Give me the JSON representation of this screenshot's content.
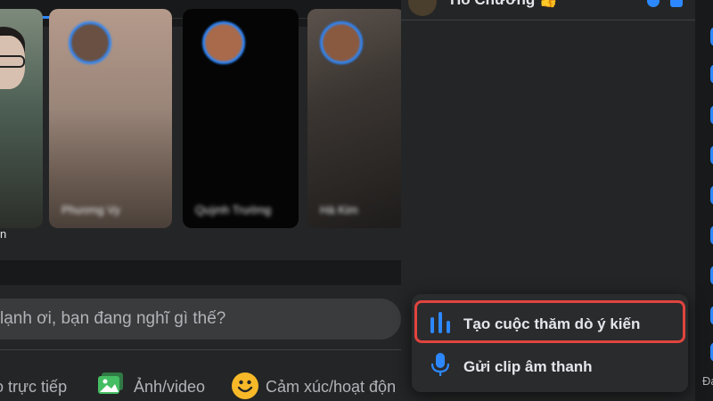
{
  "feed": {
    "story_left_label": "n",
    "stories": [
      {
        "name": "Phương Vy"
      },
      {
        "name": "Quỳnh Trường"
      },
      {
        "name": "Hà Kim"
      }
    ],
    "composer_placeholder": "lạnh ơi, bạn đang nghĩ gì thế?",
    "actions": {
      "live": "o trực tiếp",
      "photo": "Ảnh/video",
      "feeling": "Cảm xúc/hoạt độn"
    }
  },
  "chat": {
    "title": "Hồ Chương 👍",
    "menu": [
      {
        "label": "Tạo cuộc thăm dò ý kiến",
        "icon": "poll-icon"
      },
      {
        "label": "Gửi clip âm thanh",
        "icon": "microphone-icon"
      }
    ]
  },
  "right_strip": {
    "text": "Đa"
  },
  "colors": {
    "accent": "#2d88ff",
    "highlight": "#e0443e",
    "feeling": "#f7b928",
    "photo": "#45bd62"
  }
}
